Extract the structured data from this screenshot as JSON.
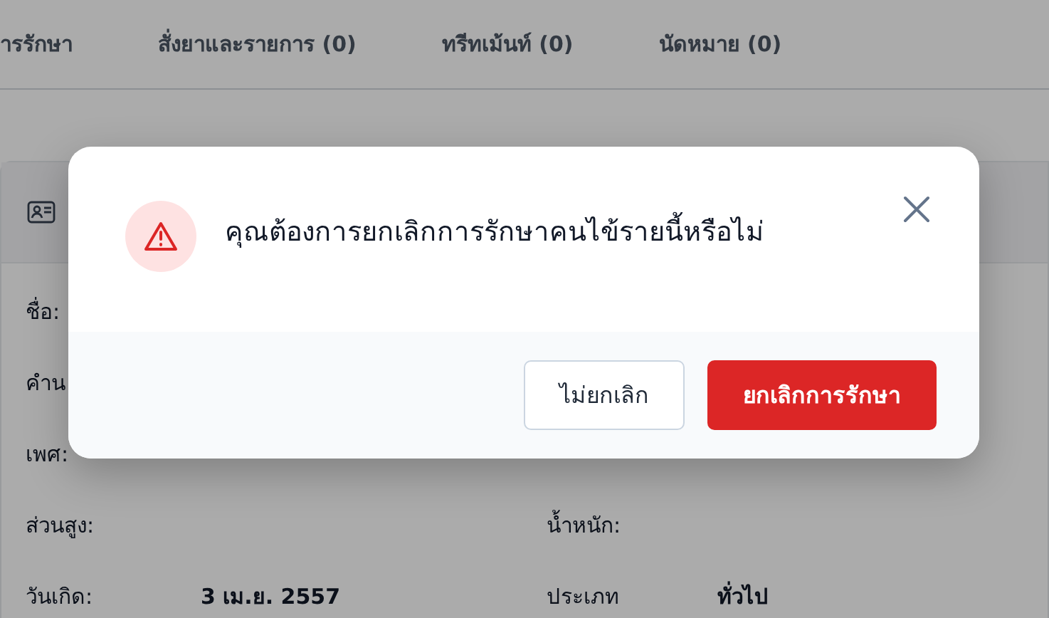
{
  "tabs": [
    {
      "label": "ารรักษา"
    },
    {
      "label": "สั่งยาและรายการ (0)"
    },
    {
      "label": "ทรีทเม้นท์ (0)"
    },
    {
      "label": "นัดหมาย (0)"
    }
  ],
  "patient_rows": [
    {
      "left_label": "ชื่อ:"
    },
    {
      "left_label": "คำน"
    },
    {
      "left_label": "เพศ:"
    },
    {
      "left_label": "ส่วนสูง:",
      "right_label": "น้ำหนัก:"
    },
    {
      "left_label": "วันเกิด:",
      "left_value": "3 เม.ย. 2557",
      "right_label": "ประเภท",
      "right_value": "ทั่วไป"
    }
  ],
  "dialog": {
    "message": "คุณต้องการยกเลิกการรักษาคนไข้รายนี้หรือไม่",
    "buttons": [
      {
        "label": "ไม่ยกเลิก",
        "kind": "secondary"
      },
      {
        "label": "ยกเลิกการรักษา",
        "kind": "danger"
      }
    ]
  }
}
